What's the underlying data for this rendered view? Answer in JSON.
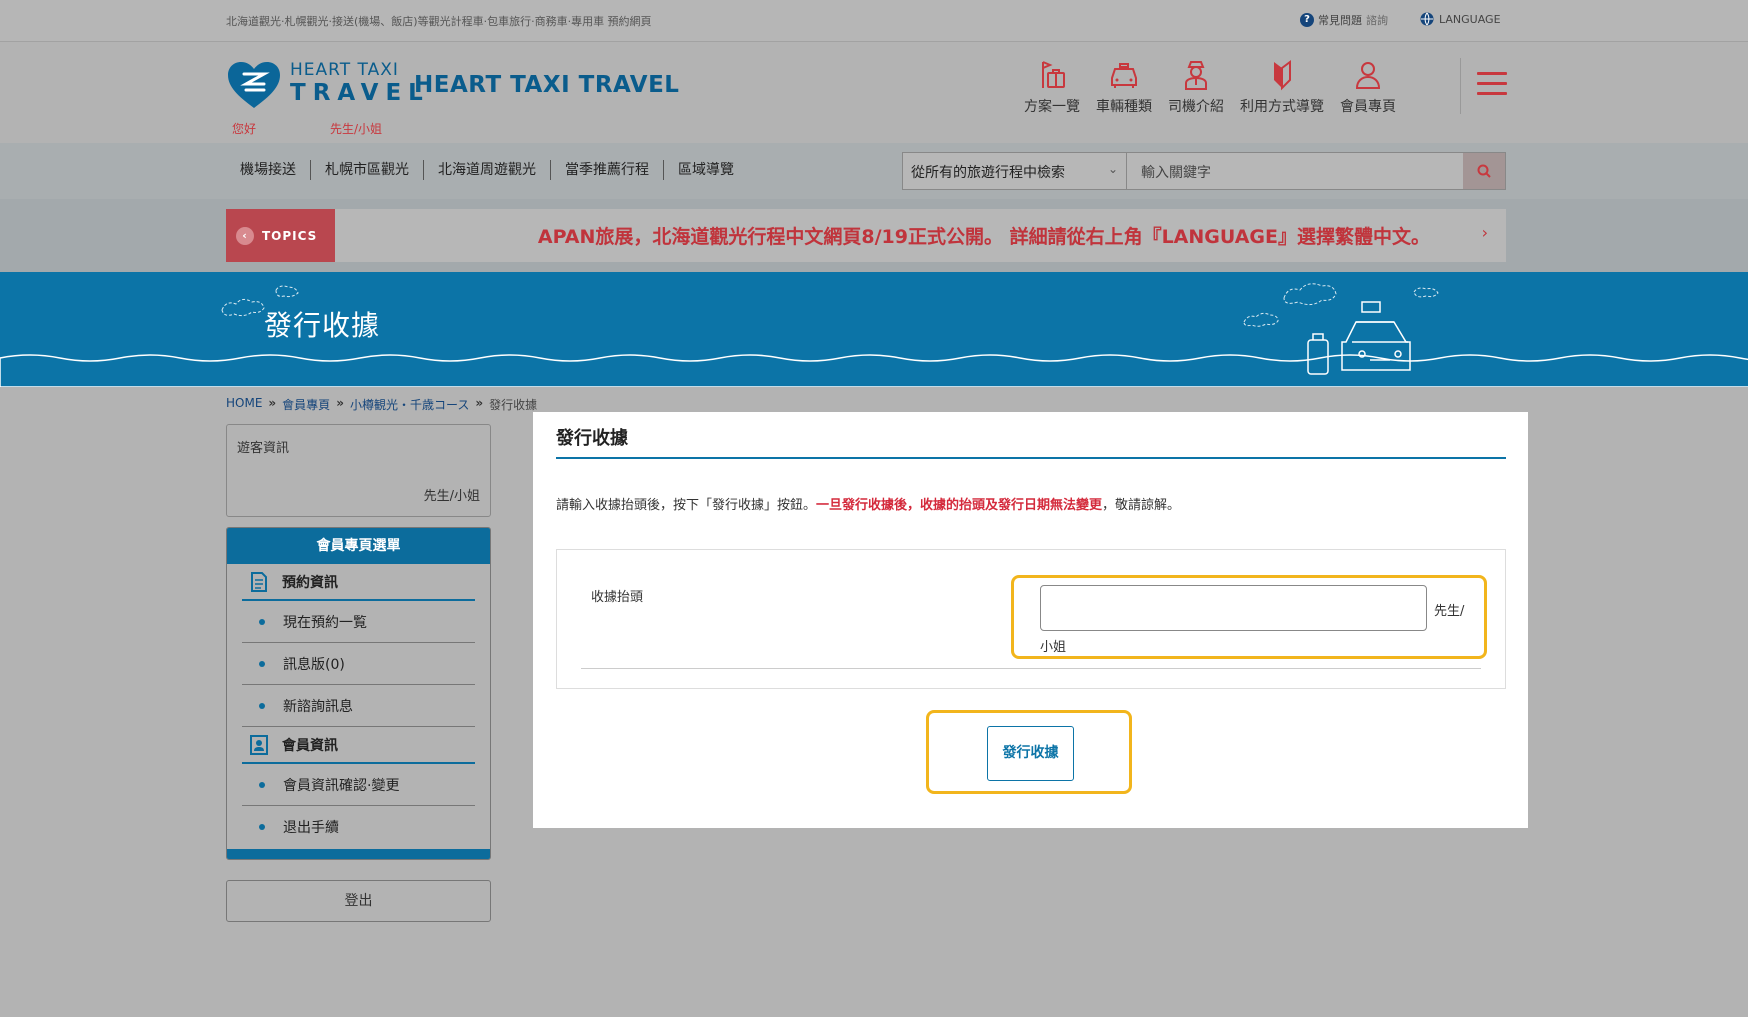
{
  "topbar": {
    "tagline": "北海道觀光·札幌觀光·接送(機場、飯店)等觀光計程車·包車旅行·商務車·專用車 預約網頁",
    "faq_label": "常見問題",
    "faq_sub": "諮詢",
    "language_label": "LANGUAGE"
  },
  "header": {
    "logo_line1": "HEART TAXI",
    "logo_line2": "TRAVEL",
    "brand_name": "HEART TAXI TRAVEL",
    "greeting": "您好",
    "honorific": "先生/小姐",
    "nav": [
      {
        "label": "方案一覽",
        "icon": "luggage-icon"
      },
      {
        "label": "車輛種類",
        "icon": "taxi-icon"
      },
      {
        "label": "司機介紹",
        "icon": "driver-icon"
      },
      {
        "label": "利用方式導覽",
        "icon": "beginner-mark-icon"
      },
      {
        "label": "會員專頁",
        "icon": "user-icon"
      }
    ]
  },
  "categories": [
    "機場接送",
    "札幌市區觀光",
    "北海道周遊觀光",
    "當季推薦行程",
    "區域導覽"
  ],
  "search": {
    "scope": "從所有的旅遊行程中檢索",
    "placeholder": "輸入關鍵字"
  },
  "topics": {
    "label": "TOPICS",
    "message": "APAN旅展，北海道觀光行程中文網頁8/19正式公開。 詳細請從右上角『LANGUAGE』選擇繁體中文。"
  },
  "page_title": "發行收據",
  "breadcrumb": [
    "HOME",
    "會員專頁",
    "小樽観光・千歳コース",
    "發行收據"
  ],
  "sidebar": {
    "user_box_title": "遊客資訊",
    "user_box_name": "先生/小姐",
    "menu_header": "會員專頁選單",
    "section1": "預約資訊",
    "section1_items": [
      "現在預約一覧",
      "訊息版(0)",
      "新諮詢訊息"
    ],
    "section2": "會員資訊",
    "section2_items": [
      "會員資訊確認·變更",
      "退出手續"
    ],
    "logout": "登出"
  },
  "main": {
    "heading": "發行收據",
    "note_pre": "請輸入收據抬頭後，按下「發行收據」按鈕。",
    "note_warn": "一旦發行收據後，收據的抬頭及發行日期無法變更",
    "note_post": "，敬請諒解。",
    "field_label": "收據抬頭",
    "field_value": "",
    "suffix_part1": "先生/",
    "suffix_part2": "小姐",
    "issue_button": "發行收據"
  },
  "colors": {
    "brand_blue": "#0c74a7",
    "accent_red": "#c8383e",
    "highlight": "#f2b51c"
  }
}
